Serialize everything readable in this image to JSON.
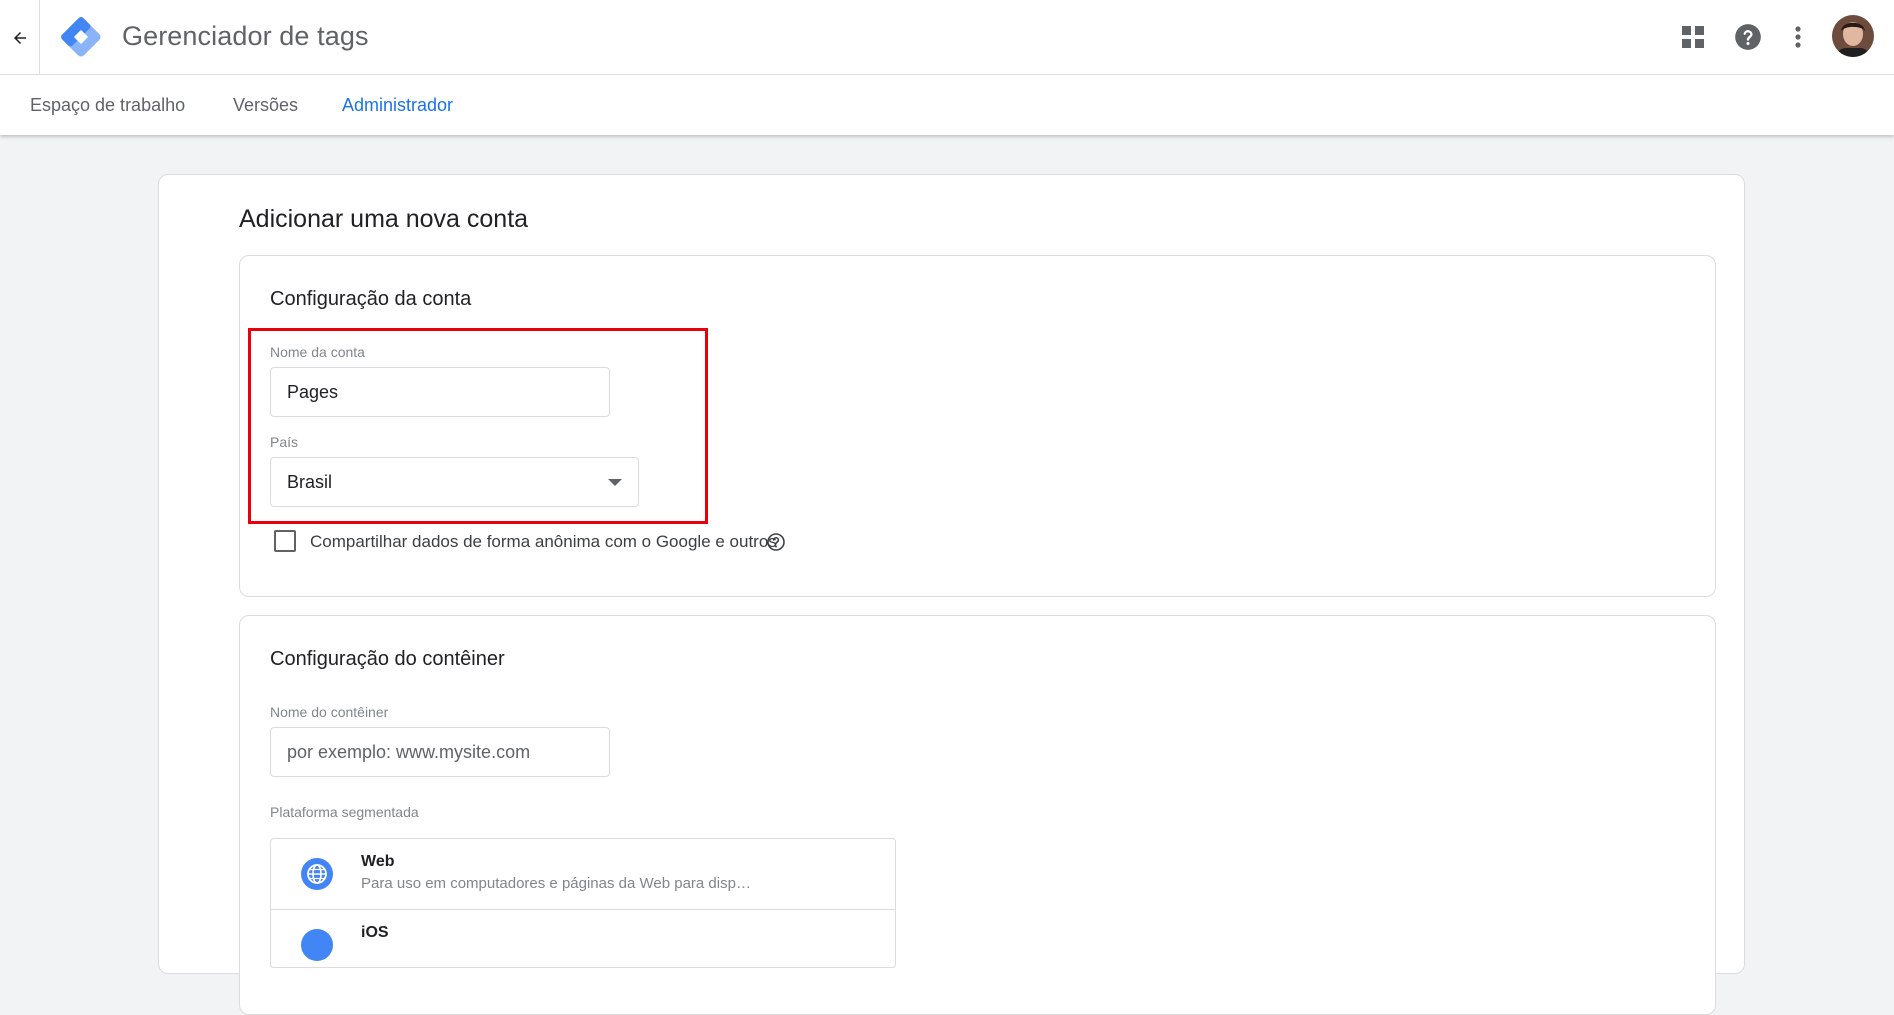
{
  "header": {
    "app_title": "Gerenciador de tags",
    "icons": [
      "back-arrow-icon",
      "tag-manager-logo",
      "apps-grid-icon",
      "help-icon",
      "more-vert-icon",
      "avatar"
    ]
  },
  "tabs": [
    {
      "label": "Espaço de trabalho",
      "active": false
    },
    {
      "label": "Versões",
      "active": false
    },
    {
      "label": "Administrador",
      "active": true
    }
  ],
  "colors": {
    "accent": "#1a73e8",
    "highlight": "#e8000d",
    "logo_light": "#8ab4f8",
    "logo_dark": "#4285f4"
  },
  "page": {
    "heading": "Adicionar uma nova conta"
  },
  "account_section": {
    "title": "Configuração da conta",
    "name_label": "Nome da conta",
    "name_value": "Pages",
    "country_label": "País",
    "country_value": "Brasil",
    "share_label": "Compartilhar dados de forma anônima com o Google e outros",
    "share_checked": false
  },
  "container_section": {
    "title": "Configuração do contêiner",
    "name_label": "Nome do contêiner",
    "name_placeholder": "por exemplo: www.mysite.com",
    "platform_label": "Plataforma segmentada",
    "platforms": [
      {
        "title": "Web",
        "desc": "Para uso em computadores e páginas da Web para disp…",
        "icon": "globe-icon"
      },
      {
        "title": "iOS",
        "desc": "",
        "icon": "ios-icon"
      }
    ]
  }
}
